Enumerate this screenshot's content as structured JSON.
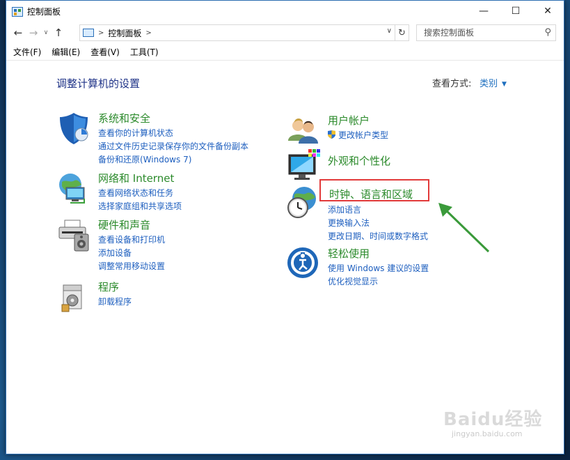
{
  "window": {
    "title": "控制面板",
    "controls": {
      "minimize": "—",
      "maximize": "☐",
      "close": "✕"
    }
  },
  "nav": {
    "back": "←",
    "forward": "→",
    "recent": "∨",
    "up": "↑",
    "address_path": "控制面板",
    "address_sep": ">",
    "address_dropdown": "∨",
    "refresh": "↻",
    "search_placeholder": "搜索控制面板"
  },
  "menu": [
    "文件(F)",
    "编辑(E)",
    "查看(V)",
    "工具(T)"
  ],
  "content": {
    "page_title": "调整计算机的设置",
    "view_by_label": "查看方式:",
    "view_by_value": "类别",
    "categories": [
      {
        "title": "系统和安全",
        "links": [
          "查看你的计算机状态",
          "通过文件历史记录保存你的文件备份副本",
          "备份和还原(Windows 7)"
        ]
      },
      {
        "title": "网络和 Internet",
        "links": [
          "查看网络状态和任务",
          "选择家庭组和共享选项"
        ]
      },
      {
        "title": "硬件和声音",
        "links": [
          "查看设备和打印机",
          "添加设备",
          "调整常用移动设置"
        ]
      },
      {
        "title": "程序",
        "links": [
          "卸载程序"
        ]
      },
      {
        "title": "用户帐户",
        "links": [
          "更改帐户类型"
        ]
      },
      {
        "title": "外观和个性化",
        "links": []
      },
      {
        "title": "时钟、语言和区域",
        "links": [
          "添加语言",
          "更换输入法",
          "更改日期、时间或数字格式"
        ]
      },
      {
        "title": "轻松使用",
        "links": [
          "使用 Windows 建议的设置",
          "优化视觉显示"
        ]
      }
    ]
  },
  "watermark": {
    "main": "Baidu经验",
    "sub": "jingyan.baidu.com"
  },
  "colors": {
    "title_blue": "#1e3287",
    "category_green": "#2b8a2b",
    "link_blue": "#1e5fbf",
    "highlight_red": "#e23a3a",
    "arrow_green": "#3a9a3a"
  }
}
